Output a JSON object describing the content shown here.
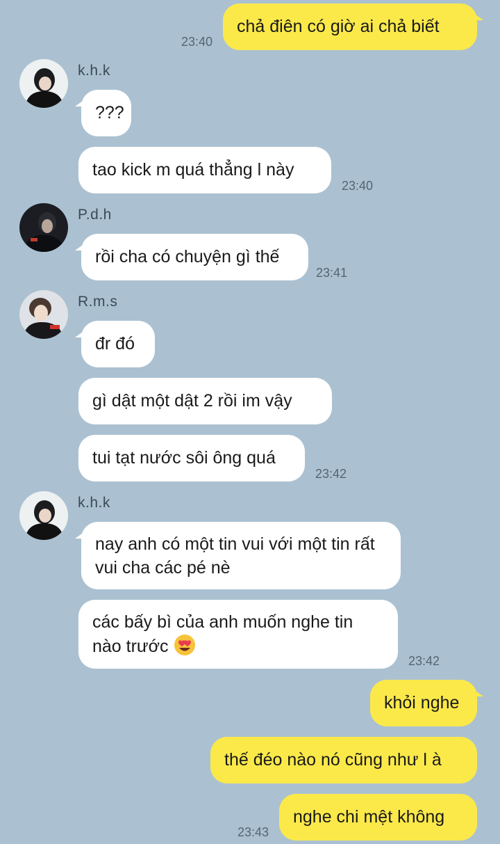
{
  "messages": {
    "m1": {
      "text": "chả điên có giờ ai chả biết",
      "time": "23:40"
    },
    "g1": {
      "sender": "k.h.k",
      "avatar_icon": "profile-photo-khk",
      "m1": "???",
      "m2": "tao kick m quá thẳng l này",
      "time": "23:40"
    },
    "g2": {
      "sender": "P.d.h",
      "avatar_icon": "profile-photo-pdh",
      "m1": "rồi cha có chuyện gì thế",
      "time": "23:41"
    },
    "g3": {
      "sender": "R.m.s",
      "avatar_icon": "profile-photo-rms",
      "m1": "đr đó",
      "m2": "gì dật một dật 2 rồi im vậy",
      "m3": "tui tạt nước sôi ông quá",
      "time": "23:42"
    },
    "g4": {
      "sender": "k.h.k",
      "avatar_icon": "profile-photo-khk",
      "m1": "nay anh có một tin vui với một tin rất vui cha các pé nè",
      "m2": "các bấy bì của anh muốn nghe tin nào trước",
      "m2_emoji": "heart-eyes-emoji",
      "time": "23:42"
    },
    "mine2": {
      "m1": "khỏi nghe",
      "m2": "thế đéo nào nó cũng như l à",
      "m3": "nghe chi mệt không",
      "time": "23:43"
    }
  },
  "colors": {
    "background": "#abc1d1",
    "my_bubble": "#fbe94a",
    "their_bubble": "#ffffff"
  }
}
